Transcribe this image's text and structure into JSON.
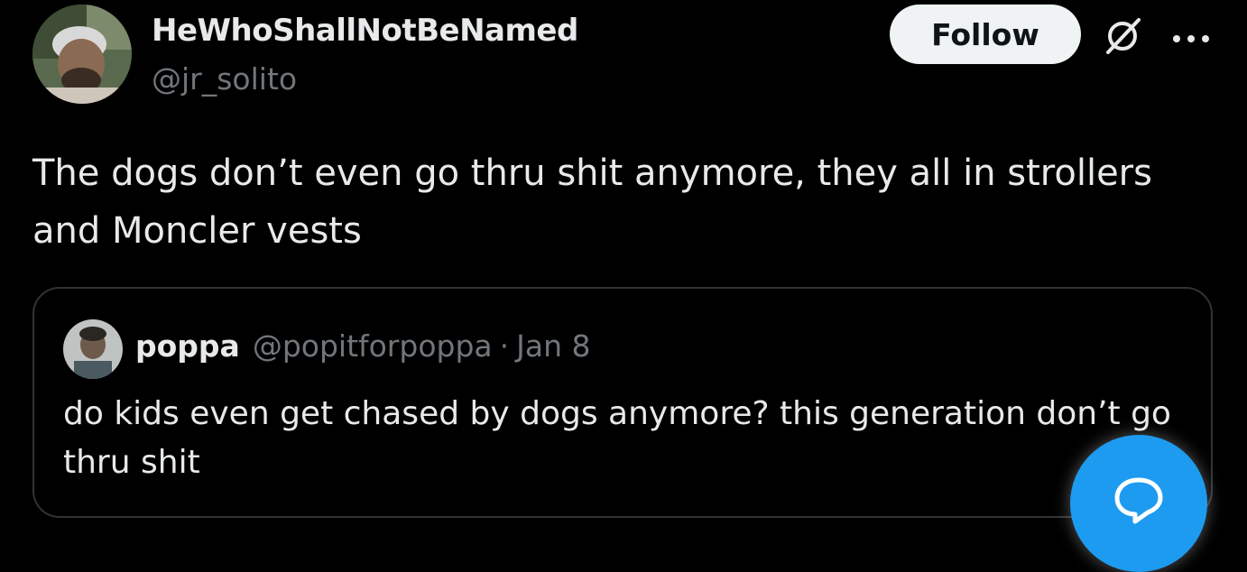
{
  "tweet": {
    "author": {
      "display_name": "HeWhoShallNotBeNamed",
      "handle": "@jr_solito"
    },
    "follow_label": "Follow",
    "text": "The dogs don’t even go thru shit anymore, they all in strollers and Moncler vests"
  },
  "quote": {
    "author_name": "poppa",
    "author_handle": "@popitforpoppa",
    "separator": "·",
    "date": "Jan 8",
    "text": "do kids even get chased by dogs anymore? this generation don’t go thru shit"
  },
  "icons": {
    "grok": "grok-icon",
    "more": "more-icon",
    "reply": "reply-icon"
  },
  "colors": {
    "background": "#000000",
    "text_primary": "#e7e9ea",
    "text_secondary": "#71767b",
    "accent": "#1d9bf0",
    "follow_bg": "#eff3f4"
  }
}
